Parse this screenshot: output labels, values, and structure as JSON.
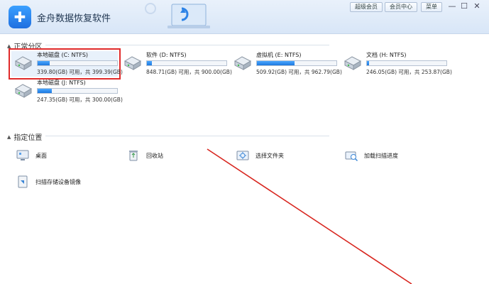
{
  "app": {
    "title": "金舟数据恢复软件",
    "buttons": [
      "超级会员",
      "会员中心",
      "菜单"
    ],
    "window_controls": [
      "—",
      "☐",
      "✕"
    ]
  },
  "sections": {
    "partitions": "正常分区",
    "locations": "指定位置"
  },
  "drives": [
    {
      "name": "本地磁盘 (C: NTFS)",
      "info": "339.80(GB) 可用，共 399.39(GB)",
      "used_fraction": 0.15,
      "selected": true
    },
    {
      "name": "软件 (D: NTFS)",
      "info": "848.71(GB) 可用，共 900.00(GB)",
      "used_fraction": 0.06,
      "selected": false
    },
    {
      "name": "虚拟机 (E: NTFS)",
      "info": "509.92(GB) 可用，共 962.79(GB)",
      "used_fraction": 0.47,
      "selected": false
    },
    {
      "name": "文档 (H: NTFS)",
      "info": "246.05(GB) 可用，共 253.87(GB)",
      "used_fraction": 0.03,
      "selected": false
    },
    {
      "name": "本地磁盘 (J: NTFS)",
      "info": "247.35(GB) 可用，共 300.00(GB)",
      "used_fraction": 0.18,
      "selected": false
    }
  ],
  "locations": [
    {
      "label": "桌面",
      "icon": "desktop-icon"
    },
    {
      "label": "回收站",
      "icon": "recycle-bin-icon"
    },
    {
      "label": "选择文件夹",
      "icon": "folder-select-icon"
    },
    {
      "label": "加载扫描进度",
      "icon": "load-scan-icon"
    },
    {
      "label": "扫描存储设备镜像",
      "icon": "disk-image-icon"
    }
  ],
  "colors": {
    "accent": "#1d78df",
    "highlight": "#e02a2a"
  }
}
